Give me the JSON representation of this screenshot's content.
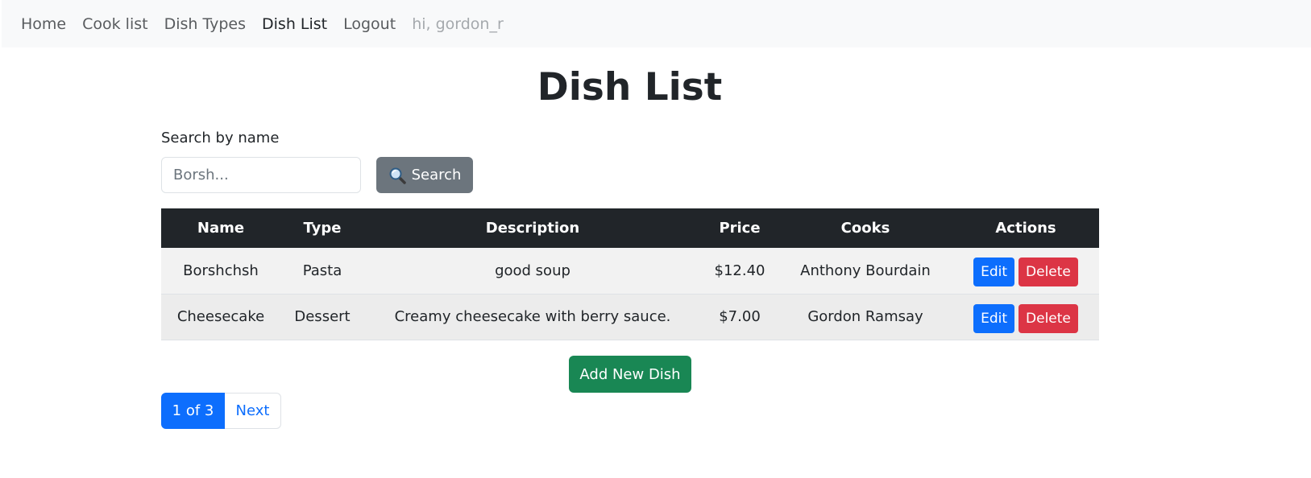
{
  "nav": {
    "items": [
      {
        "label": "Home",
        "active": false
      },
      {
        "label": "Cook list",
        "active": false
      },
      {
        "label": "Dish Types",
        "active": false
      },
      {
        "label": "Dish List",
        "active": true
      },
      {
        "label": "Logout",
        "active": false
      }
    ],
    "greeting": "hi, gordon_r"
  },
  "page": {
    "title": "Dish List"
  },
  "search": {
    "label": "Search by name",
    "placeholder": "Borsh...",
    "value": "",
    "button_label": "Search",
    "button_icon": "magnifier-icon"
  },
  "table": {
    "headers": [
      "Name",
      "Type",
      "Description",
      "Price",
      "Cooks",
      "Actions"
    ],
    "rows": [
      {
        "name": "Borshchsh",
        "type": "Pasta",
        "description": "good soup",
        "price": "$12.40",
        "cooks": "Anthony Bourdain",
        "edit_label": "Edit",
        "delete_label": "Delete"
      },
      {
        "name": "Cheesecake",
        "type": "Dessert",
        "description": "Creamy cheesecake with berry sauce.",
        "price": "$7.00",
        "cooks": "Gordon Ramsay",
        "edit_label": "Edit",
        "delete_label": "Delete"
      }
    ]
  },
  "add_button_label": "Add New Dish",
  "pagination": {
    "current": "1 of 3",
    "next": "Next"
  },
  "colors": {
    "navbar_bg": "#f8f9fa",
    "table_header_bg": "#212529",
    "primary": "#0d6efd",
    "danger": "#dc3545",
    "success": "#198754",
    "secondary": "#6c757d"
  }
}
